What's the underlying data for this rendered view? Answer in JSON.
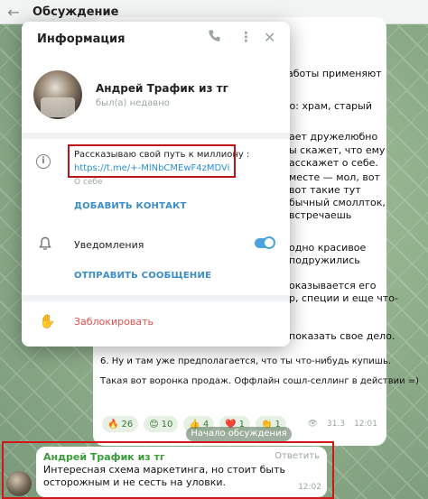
{
  "header": {
    "title": "Обсуждение"
  },
  "post": {
    "lines": [
      "аботы применяют",
      "ю: храм, старый",
      "ает дружелюбно",
      "ы скажет, что ему",
      "асскажет о себе.",
      "месте — мол, вот",
      "вот такие тут",
      "бычный смоллток,",
      "встречаешь",
      "одно красивое",
      "подружились",
      "оказывается его",
      "р, специи и еще что-",
      "показать свое дело.",
      "6. Ну и там уже предполагается, что ты что-нибудь купишь.",
      "Такая вот воронка продаж. Оффлайн сошл-селлинг в действии =)"
    ],
    "reactions": [
      {
        "emoji": "🔥",
        "count": "26"
      },
      {
        "emoji": "😊",
        "count": "10"
      },
      {
        "emoji": "👍",
        "count": "4"
      },
      {
        "emoji": "❤️",
        "count": "1"
      },
      {
        "emoji": "👏",
        "count": "1"
      }
    ],
    "views": "31.3",
    "time": "12:01"
  },
  "divider": {
    "label": "Начало обсуждения"
  },
  "comment": {
    "author": "Андрей Трафик из тг",
    "reply_label": "Ответить",
    "text": "Интересная схема маркетинга, но стоит быть осторожным и не сесть на уловки.",
    "time": "12:02"
  },
  "modal": {
    "title": "Информация",
    "profile": {
      "name": "Андрей Трафик из тг",
      "status": "был(а) недавно"
    },
    "bio": {
      "text": "Рассказываю свой путь к миллиону :",
      "link": "https://t.me/+-MlNbCMEwF4zMDVi",
      "label": "О себе"
    },
    "add_contact": "ДОБАВИТЬ КОНТАКТ",
    "notifications": {
      "label": "Уведомления",
      "enabled": true
    },
    "send_message": "ОТПРАВИТЬ СООБЩЕНИЕ",
    "block": "Заблокировать"
  },
  "colors": {
    "accent": "#3a8dc8",
    "danger": "#e05050",
    "highlight": "#c0141c",
    "author": "#3a9b3a"
  },
  "icons": [
    "back-arrow-icon",
    "phone-icon",
    "more-icon",
    "close-icon",
    "info-icon",
    "bell-icon",
    "block-hand-icon",
    "eye-icon"
  ]
}
